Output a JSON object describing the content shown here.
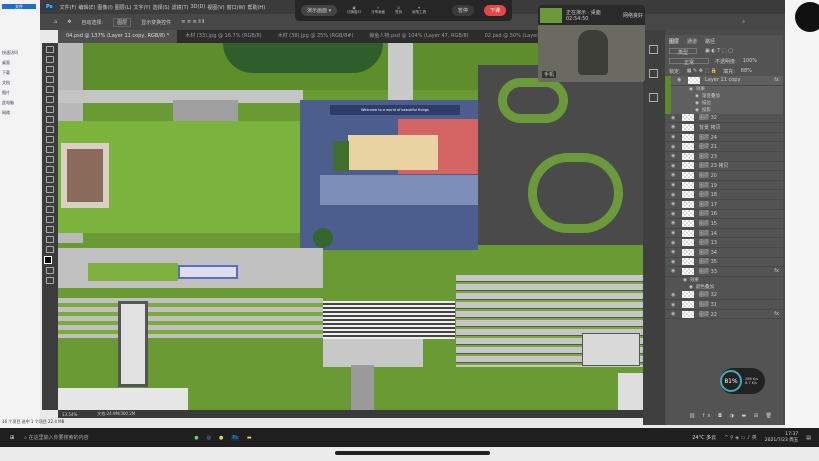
{
  "explorer": {
    "items": [
      "文件",
      "快速访问",
      "桌面",
      "下载",
      "文档",
      "图片",
      "此电脑",
      "网络"
    ],
    "footer": "16 个项目  选中 1 个项目 22.4 MB"
  },
  "menu": [
    "文件(F)",
    "编辑(E)",
    "图像(I)",
    "图层(L)",
    "文字(Y)",
    "选择(S)",
    "滤镜(T)",
    "3D(D)",
    "视图(V)",
    "窗口(W)",
    "帮助(H)"
  ],
  "options": {
    "auto_select": "自动选择:",
    "auto_select_value": "图层",
    "show_transform": "显示变换控件"
  },
  "tabs": [
    "04.psd @ 137% (Layer 11 copy, RGB/8) *",
    "木材 (33).jpg @ 16.7% (RGB/8)",
    "木材 (38).jpg @ 25% (RGB/8#)",
    "鲸鱼人物.psd @ 104% (Layer 47, RGB/8)",
    "02.psd @ 50% (Layer 11 copy, RGB/8)"
  ],
  "meeting": {
    "present": "演示画面 ▾",
    "buttons": [
      "切换窗口",
      "分享画面",
      "签到",
      "画笔工具"
    ],
    "pause": "暂停",
    "end": "下课",
    "end_color": "#e84545"
  },
  "video": {
    "status": "正在演示 · 桌面",
    "time": "02:54:50",
    "network": "网络良好",
    "label": "手机"
  },
  "canvas_labels": {
    "banner": "Welcome to a world of beautiful things"
  },
  "status": {
    "zoom": "13.54%",
    "doc": "文档:24.9M/300.2M"
  },
  "layers_panel": {
    "tabs": [
      "图层",
      "通道",
      "路径"
    ],
    "filter": "类型",
    "blend": "正常",
    "opacity_label": "不透明度:",
    "opacity": "100%",
    "lock_label": "锁定:",
    "fill_label": "填充:",
    "fill": "88%",
    "selected": {
      "name": "Layer 11 copy",
      "effects_label": "效果",
      "effects": [
        "渐变叠加",
        "描边",
        "投影"
      ]
    },
    "layers": [
      "图层 32",
      "背景 拷贝",
      "图层 24",
      "图层 21",
      "图层 23",
      "图层 23 拷贝",
      "图层 20",
      "图层 19",
      "图层 18",
      "图层 17",
      "图层 16",
      "图层 15",
      "图层 14",
      "图层 13",
      "图层 34",
      "图层 35",
      "图层 33"
    ],
    "layer33_effects": [
      "效果",
      "颜色叠加"
    ],
    "after": [
      "图层 32",
      "图层 31",
      "图层 22"
    ]
  },
  "perf": {
    "cpu": "81%",
    "up": "288 K/s",
    "down": "8.7 K/s"
  },
  "taskbar": {
    "search": "在这里输入你要搜索的内容",
    "weather": "24°C 多云",
    "time": "17:37",
    "date": "2021/7/23 周五"
  }
}
